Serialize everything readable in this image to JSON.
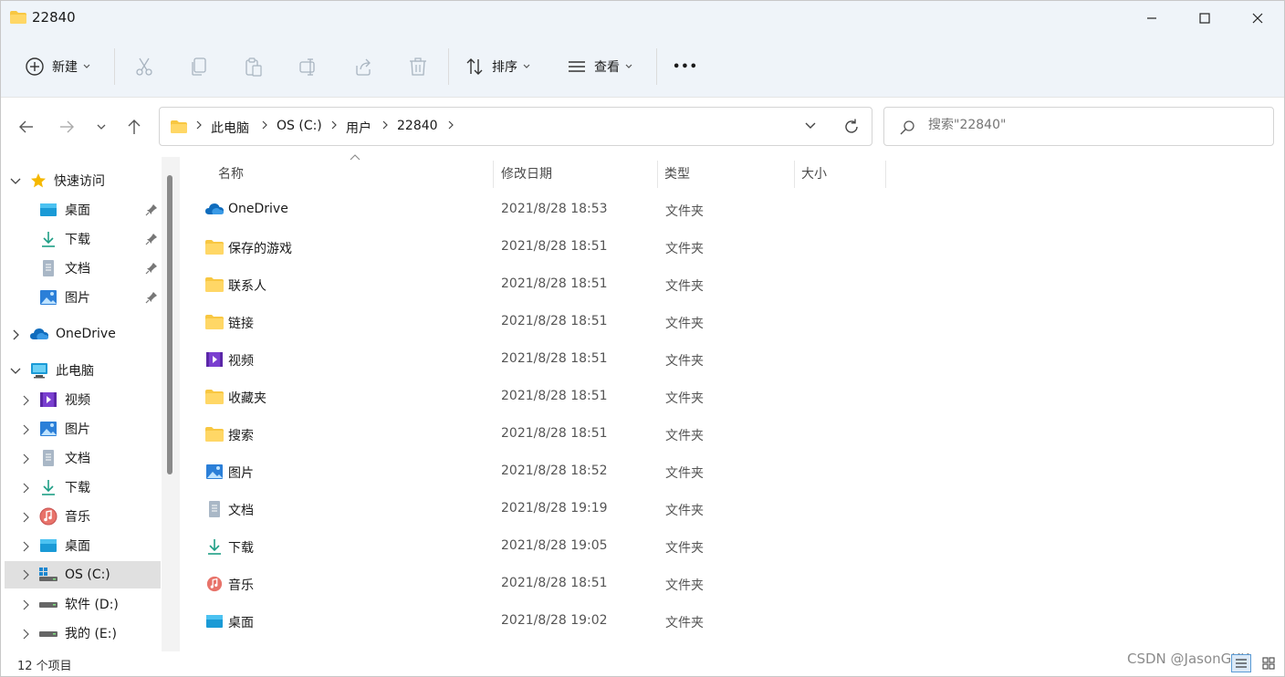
{
  "window": {
    "title": "22840"
  },
  "commandbar": {
    "new_label": "新建",
    "sort_label": "排序",
    "view_label": "查看",
    "more_label": "•••"
  },
  "address": {
    "crumbs": [
      "此电脑",
      "OS (C:)",
      "用户",
      "22840"
    ]
  },
  "search": {
    "placeholder": "搜索\"22840\""
  },
  "sidebar": {
    "quick_access": "快速访问",
    "quick_items": [
      "桌面",
      "下载",
      "文档",
      "图片"
    ],
    "onedrive": "OneDrive",
    "this_pc": "此电脑",
    "pc_items": [
      "视频",
      "图片",
      "文档",
      "下载",
      "音乐",
      "桌面",
      "OS (C:)",
      "软件 (D:)",
      "我的 (E:)"
    ]
  },
  "columns": {
    "name": "名称",
    "modified": "修改日期",
    "type": "类型",
    "size": "大小"
  },
  "files": [
    {
      "name": "OneDrive",
      "date": "2021/8/28 18:53",
      "type": "文件夹",
      "icon": "onedrive-icon"
    },
    {
      "name": "保存的游戏",
      "date": "2021/8/28 18:51",
      "type": "文件夹",
      "icon": "folder-icon"
    },
    {
      "name": "联系人",
      "date": "2021/8/28 18:51",
      "type": "文件夹",
      "icon": "folder-icon"
    },
    {
      "name": "链接",
      "date": "2021/8/28 18:51",
      "type": "文件夹",
      "icon": "folder-icon"
    },
    {
      "name": "视频",
      "date": "2021/8/28 18:51",
      "type": "文件夹",
      "icon": "video-icon"
    },
    {
      "name": "收藏夹",
      "date": "2021/8/28 18:51",
      "type": "文件夹",
      "icon": "folder-icon"
    },
    {
      "name": "搜索",
      "date": "2021/8/28 18:51",
      "type": "文件夹",
      "icon": "folder-icon"
    },
    {
      "name": "图片",
      "date": "2021/8/28 18:52",
      "type": "文件夹",
      "icon": "pictures-icon"
    },
    {
      "name": "文档",
      "date": "2021/8/28 19:19",
      "type": "文件夹",
      "icon": "document-icon"
    },
    {
      "name": "下载",
      "date": "2021/8/28 19:05",
      "type": "文件夹",
      "icon": "download-icon"
    },
    {
      "name": "音乐",
      "date": "2021/8/28 18:51",
      "type": "文件夹",
      "icon": "music-icon"
    },
    {
      "name": "桌面",
      "date": "2021/8/28 19:02",
      "type": "文件夹",
      "icon": "desktop-icon"
    }
  ],
  "status": {
    "item_count": "12 个项目",
    "watermark": "CSDN @JasonGKK"
  },
  "colors": {
    "chrome_bg": "#eff4f9",
    "folder": "#f8c742",
    "accent": "#0067c0"
  }
}
